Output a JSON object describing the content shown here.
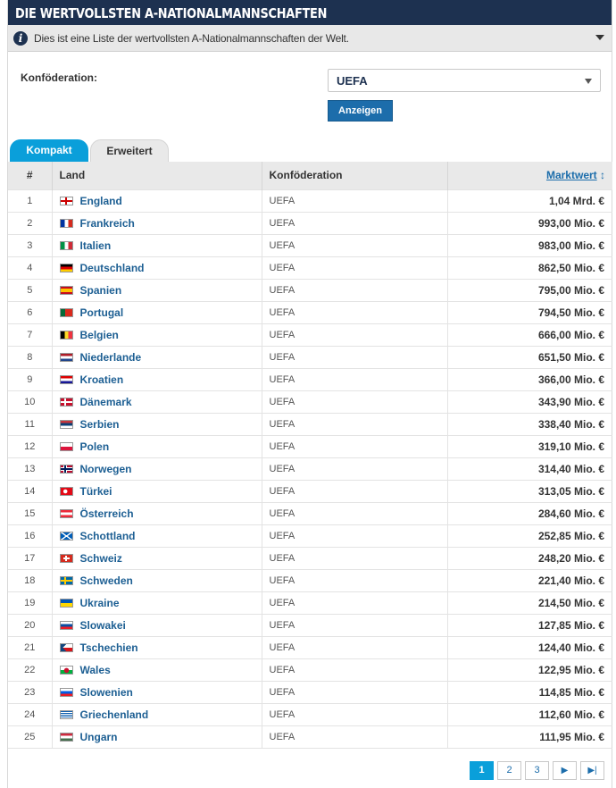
{
  "header": {
    "title": "DIE WERTVOLLSTEN A-NATIONALMANNSCHAFTEN"
  },
  "info": {
    "text": "Dies ist eine Liste der wertvollsten A-Nationalmannschaften der Welt."
  },
  "filter": {
    "label": "Konföderation:",
    "selected": "UEFA",
    "button_label": "Anzeigen"
  },
  "tabs": [
    {
      "label": "Kompakt",
      "active": true
    },
    {
      "label": "Erweitert",
      "active": false
    }
  ],
  "table": {
    "columns": [
      "#",
      "Land",
      "Konföderation",
      "Marktwert"
    ],
    "sort_indicator": "↕",
    "rows": [
      {
        "rank": "1",
        "country": "England",
        "flag": "england",
        "confed": "UEFA",
        "value": "1,04 Mrd. €"
      },
      {
        "rank": "2",
        "country": "Frankreich",
        "flag": "france",
        "confed": "UEFA",
        "value": "993,00 Mio. €"
      },
      {
        "rank": "3",
        "country": "Italien",
        "flag": "italy",
        "confed": "UEFA",
        "value": "983,00 Mio. €"
      },
      {
        "rank": "4",
        "country": "Deutschland",
        "flag": "germany",
        "confed": "UEFA",
        "value": "862,50 Mio. €"
      },
      {
        "rank": "5",
        "country": "Spanien",
        "flag": "spain",
        "confed": "UEFA",
        "value": "795,00 Mio. €"
      },
      {
        "rank": "6",
        "country": "Portugal",
        "flag": "portugal",
        "confed": "UEFA",
        "value": "794,50 Mio. €"
      },
      {
        "rank": "7",
        "country": "Belgien",
        "flag": "belgium",
        "confed": "UEFA",
        "value": "666,00 Mio. €"
      },
      {
        "rank": "8",
        "country": "Niederlande",
        "flag": "netherlands",
        "confed": "UEFA",
        "value": "651,50 Mio. €"
      },
      {
        "rank": "9",
        "country": "Kroatien",
        "flag": "croatia",
        "confed": "UEFA",
        "value": "366,00 Mio. €"
      },
      {
        "rank": "10",
        "country": "Dänemark",
        "flag": "denmark",
        "confed": "UEFA",
        "value": "343,90 Mio. €"
      },
      {
        "rank": "11",
        "country": "Serbien",
        "flag": "serbia",
        "confed": "UEFA",
        "value": "338,40 Mio. €"
      },
      {
        "rank": "12",
        "country": "Polen",
        "flag": "poland",
        "confed": "UEFA",
        "value": "319,10 Mio. €"
      },
      {
        "rank": "13",
        "country": "Norwegen",
        "flag": "norway",
        "confed": "UEFA",
        "value": "314,40 Mio. €"
      },
      {
        "rank": "14",
        "country": "Türkei",
        "flag": "turkey",
        "confed": "UEFA",
        "value": "313,05 Mio. €"
      },
      {
        "rank": "15",
        "country": "Österreich",
        "flag": "austria",
        "confed": "UEFA",
        "value": "284,60 Mio. €"
      },
      {
        "rank": "16",
        "country": "Schottland",
        "flag": "scotland",
        "confed": "UEFA",
        "value": "252,85 Mio. €"
      },
      {
        "rank": "17",
        "country": "Schweiz",
        "flag": "switzerland",
        "confed": "UEFA",
        "value": "248,20 Mio. €"
      },
      {
        "rank": "18",
        "country": "Schweden",
        "flag": "sweden",
        "confed": "UEFA",
        "value": "221,40 Mio. €"
      },
      {
        "rank": "19",
        "country": "Ukraine",
        "flag": "ukraine",
        "confed": "UEFA",
        "value": "214,50 Mio. €"
      },
      {
        "rank": "20",
        "country": "Slowakei",
        "flag": "slovakia",
        "confed": "UEFA",
        "value": "127,85 Mio. €"
      },
      {
        "rank": "21",
        "country": "Tschechien",
        "flag": "czechia",
        "confed": "UEFA",
        "value": "124,40 Mio. €"
      },
      {
        "rank": "22",
        "country": "Wales",
        "flag": "wales",
        "confed": "UEFA",
        "value": "122,95 Mio. €"
      },
      {
        "rank": "23",
        "country": "Slowenien",
        "flag": "slovenia",
        "confed": "UEFA",
        "value": "114,85 Mio. €"
      },
      {
        "rank": "24",
        "country": "Griechenland",
        "flag": "greece",
        "confed": "UEFA",
        "value": "112,60 Mio. €"
      },
      {
        "rank": "25",
        "country": "Ungarn",
        "flag": "hungary",
        "confed": "UEFA",
        "value": "111,95 Mio. €"
      }
    ]
  },
  "pagination": {
    "pages": [
      "1",
      "2",
      "3"
    ],
    "active": "1",
    "next_icon": "next-page-icon",
    "last_icon": "last-page-icon"
  },
  "colors": {
    "header_bg": "#1d3150",
    "accent": "#0a9fda",
    "link": "#1d5f93",
    "button": "#1c6dab"
  }
}
